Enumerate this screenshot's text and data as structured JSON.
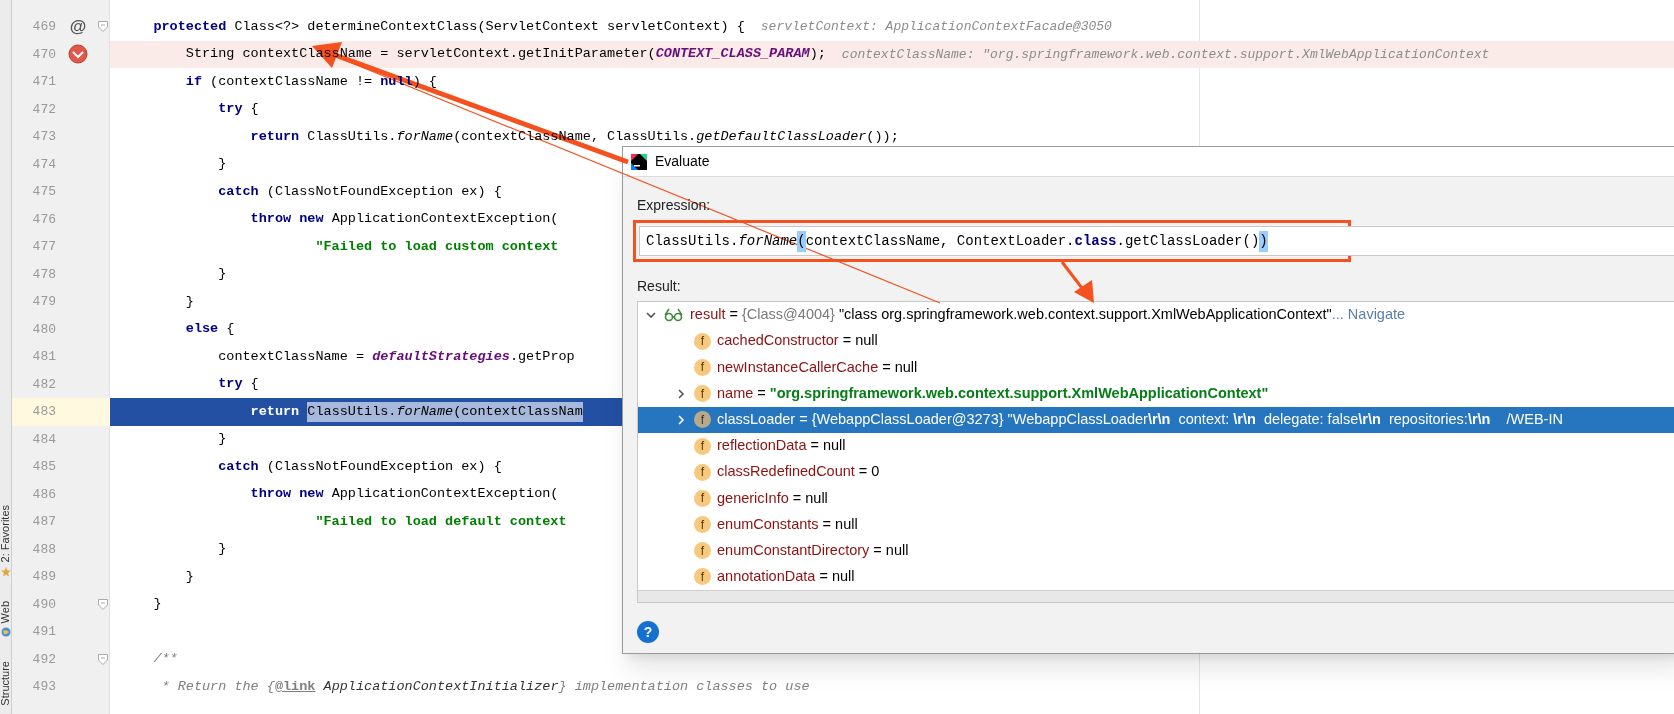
{
  "editor": {
    "side_tabs": [
      {
        "label": "2: Favorites"
      },
      {
        "label": "Web"
      },
      {
        "label": "Structure"
      }
    ],
    "lines": [
      {
        "number": "469",
        "kind": "implements",
        "mark": "@",
        "fold": true,
        "segments": [
          {
            "text": "    protected",
            "kind": "keyword"
          },
          {
            "text": " Class<?> determineContextClass(ServletContext servletContext) {",
            "kind": "plain"
          },
          {
            "text": "servletContext: ApplicationContextFacade@3050",
            "kind": "hint"
          }
        ]
      },
      {
        "number": "470",
        "kind": "breakpoint",
        "fold": false,
        "segments": [
          {
            "text": "        String contextClassName = servletContext.getInitParameter(",
            "kind": "plain"
          },
          {
            "text": "CONTEXT_CLASS_PARAM",
            "kind": "constant"
          },
          {
            "text": ");",
            "kind": "plain"
          },
          {
            "text": "contextClassName: \"org.springframework.web.context.support.XmlWebApplicationContext",
            "kind": "hint"
          }
        ]
      },
      {
        "number": "471",
        "kind": "plain",
        "fold": false,
        "segments": [
          {
            "text": "        if",
            "kind": "keyword"
          },
          {
            "text": " (contextClassName != ",
            "kind": "plain"
          },
          {
            "text": "null",
            "kind": "keyword"
          },
          {
            "text": ") {",
            "kind": "plain"
          }
        ]
      },
      {
        "number": "472",
        "kind": "plain",
        "fold": false,
        "segments": [
          {
            "text": "            try",
            "kind": "keyword"
          },
          {
            "text": " {",
            "kind": "plain"
          }
        ]
      },
      {
        "number": "473",
        "kind": "plain",
        "fold": false,
        "segments": [
          {
            "text": "                return",
            "kind": "keyword"
          },
          {
            "text": " ClassUtils.",
            "kind": "plain"
          },
          {
            "text": "forName",
            "kind": "italic"
          },
          {
            "text": "(contextClassName, ClassUtils.",
            "kind": "plain"
          },
          {
            "text": "getDefaultClassLoader",
            "kind": "italic"
          },
          {
            "text": "());",
            "kind": "plain"
          }
        ]
      },
      {
        "number": "474",
        "kind": "plain",
        "fold": false,
        "segments": [
          {
            "text": "            }",
            "kind": "plain"
          }
        ]
      },
      {
        "number": "475",
        "kind": "plain",
        "fold": false,
        "segments": [
          {
            "text": "            catch",
            "kind": "keyword"
          },
          {
            "text": " (ClassNotFoundException ex) {",
            "kind": "plain"
          }
        ]
      },
      {
        "number": "476",
        "kind": "plain",
        "fold": false,
        "segments": [
          {
            "text": "                throw new",
            "kind": "keyword"
          },
          {
            "text": " ApplicationContextException(",
            "kind": "plain"
          }
        ]
      },
      {
        "number": "477",
        "kind": "plain",
        "fold": false,
        "segments": [
          {
            "text": "                        \"Failed to load custom context",
            "kind": "string"
          }
        ]
      },
      {
        "number": "478",
        "kind": "plain",
        "fold": false,
        "segments": [
          {
            "text": "            }",
            "kind": "plain"
          }
        ]
      },
      {
        "number": "479",
        "kind": "plain",
        "fold": false,
        "segments": [
          {
            "text": "        }",
            "kind": "plain"
          }
        ]
      },
      {
        "number": "480",
        "kind": "plain",
        "fold": false,
        "segments": [
          {
            "text": "        else",
            "kind": "keyword"
          },
          {
            "text": " {",
            "kind": "plain"
          }
        ]
      },
      {
        "number": "481",
        "kind": "plain",
        "fold": false,
        "segments": [
          {
            "text": "            contextClassName = ",
            "kind": "plain"
          },
          {
            "text": "defaultStrategies",
            "kind": "field"
          },
          {
            "text": ".getProp",
            "kind": "plain"
          }
        ]
      },
      {
        "number": "482",
        "kind": "plain",
        "fold": false,
        "segments": [
          {
            "text": "            try",
            "kind": "keyword"
          },
          {
            "text": " {",
            "kind": "plain"
          }
        ]
      },
      {
        "number": "483",
        "kind": "execution",
        "fold": false,
        "segments": [
          {
            "text": "                return ",
            "kind": "keyword"
          },
          {
            "text": "ClassUtils.",
            "kind": "selection"
          },
          {
            "text": "forName",
            "kind": "selection-italic"
          },
          {
            "text": "(contextClassNam",
            "kind": "selection"
          }
        ]
      },
      {
        "number": "484",
        "kind": "plain",
        "fold": false,
        "segments": [
          {
            "text": "            }",
            "kind": "plain"
          }
        ]
      },
      {
        "number": "485",
        "kind": "plain",
        "fold": false,
        "segments": [
          {
            "text": "            catch",
            "kind": "keyword"
          },
          {
            "text": " (ClassNotFoundException ex) {",
            "kind": "plain"
          }
        ]
      },
      {
        "number": "486",
        "kind": "plain",
        "fold": false,
        "segments": [
          {
            "text": "                throw new",
            "kind": "keyword"
          },
          {
            "text": " ApplicationContextException(",
            "kind": "plain"
          }
        ]
      },
      {
        "number": "487",
        "kind": "plain",
        "fold": false,
        "segments": [
          {
            "text": "                        \"Failed to load default context",
            "kind": "string"
          }
        ]
      },
      {
        "number": "488",
        "kind": "plain",
        "fold": false,
        "segments": [
          {
            "text": "            }",
            "kind": "plain"
          }
        ]
      },
      {
        "number": "489",
        "kind": "plain",
        "fold": false,
        "segments": [
          {
            "text": "        }",
            "kind": "plain"
          }
        ]
      },
      {
        "number": "490",
        "kind": "plain",
        "fold": true,
        "segments": [
          {
            "text": "    }",
            "kind": "plain"
          }
        ]
      },
      {
        "number": "491",
        "kind": "plain",
        "fold": false
      },
      {
        "number": "492",
        "kind": "plain",
        "fold": true,
        "segments": [
          {
            "text": "    /**",
            "kind": "comment"
          }
        ]
      },
      {
        "number": "493",
        "kind": "plain",
        "fold": false,
        "segments": [
          {
            "text": "     * Return the {",
            "kind": "comment"
          },
          {
            "text": "@link",
            "kind": "doc-tag"
          },
          {
            "text": " ApplicationContextInitializer",
            "kind": "doc-ref"
          },
          {
            "text": "} implementation classes to use",
            "kind": "comment"
          }
        ]
      }
    ]
  },
  "evaluate_dialog": {
    "title": "Evaluate",
    "expression_label": "Expression:",
    "expression": [
      {
        "text": "ClassUtils.",
        "kind": "plain"
      },
      {
        "text": "forName",
        "kind": "italic"
      },
      {
        "text": "(",
        "kind": "bracket-match"
      },
      {
        "text": "contextClassName, ContextLoader.",
        "kind": "plain"
      },
      {
        "text": "class",
        "kind": "keyword"
      },
      {
        "text": ".getClassLoader()",
        "kind": "plain"
      },
      {
        "text": ")",
        "kind": "bracket-match"
      }
    ],
    "result_label": "Result:",
    "results": [
      {
        "name": "result",
        "kind": "watch",
        "has_children": true,
        "expanded": true,
        "selected": false,
        "value": [
          {
            "text": " = ",
            "kind": "plain"
          },
          {
            "text": "{Class@4004} ",
            "kind": "ref"
          },
          {
            "text": "\"class org.springframework.web.context.support.XmlWebApplicationContext\"",
            "kind": "plain"
          },
          {
            "text": "... Navigate",
            "kind": "link"
          }
        ],
        "children": [
          {
            "name": "cachedConstructor",
            "kind": "field",
            "badge": "f",
            "has_children": false,
            "expanded": false,
            "selected": false,
            "value": [
              {
                "text": " = null",
                "kind": "plain"
              }
            ]
          },
          {
            "name": "newInstanceCallerCache",
            "kind": "field",
            "badge": "f",
            "has_children": false,
            "expanded": false,
            "selected": false,
            "value": [
              {
                "text": " = null",
                "kind": "plain"
              }
            ]
          },
          {
            "name": "name",
            "kind": "field",
            "badge": "f",
            "has_children": true,
            "expanded": false,
            "selected": false,
            "value": [
              {
                "text": " = ",
                "kind": "plain"
              },
              {
                "text": "\"org.springframework.web.context.support.XmlWebApplicationContext\"",
                "kind": "string"
              }
            ]
          },
          {
            "name": "classLoader",
            "kind": "field",
            "badge": "f",
            "has_children": true,
            "expanded": false,
            "selected": true,
            "value": [
              {
                "text": " = ",
                "kind": "plain"
              },
              {
                "text": "{WebappClassLoader@3273} ",
                "kind": "ref"
              },
              {
                "text": "\"WebappClassLoader**\\r\\n**  context: **\\r\\n**  delegate: false**\\r\\n**  repositories:**\\r\\n**    /WEB-IN",
                "kind": "rich"
              }
            ]
          },
          {
            "name": "reflectionData",
            "kind": "field",
            "badge": "f",
            "has_children": false,
            "expanded": false,
            "selected": false,
            "value": [
              {
                "text": " = null",
                "kind": "plain"
              }
            ]
          },
          {
            "name": "classRedefinedCount",
            "kind": "field",
            "badge": "f",
            "has_children": false,
            "expanded": false,
            "selected": false,
            "value": [
              {
                "text": " = 0",
                "kind": "plain"
              }
            ]
          },
          {
            "name": "genericInfo",
            "kind": "field",
            "badge": "f",
            "has_children": false,
            "expanded": false,
            "selected": false,
            "value": [
              {
                "text": " = null",
                "kind": "plain"
              }
            ]
          },
          {
            "name": "enumConstants",
            "kind": "field",
            "badge": "f",
            "has_children": false,
            "expanded": false,
            "selected": false,
            "value": [
              {
                "text": " = null",
                "kind": "plain"
              }
            ]
          },
          {
            "name": "enumConstantDirectory",
            "kind": "field",
            "badge": "f",
            "has_children": false,
            "expanded": false,
            "selected": false,
            "value": [
              {
                "text": " = null",
                "kind": "plain"
              }
            ]
          },
          {
            "name": "annotationData",
            "kind": "field",
            "badge": "f",
            "has_children": false,
            "expanded": false,
            "selected": false,
            "value": [
              {
                "text": " = null",
                "kind": "plain"
              }
            ]
          }
        ]
      }
    ],
    "help": "?"
  }
}
